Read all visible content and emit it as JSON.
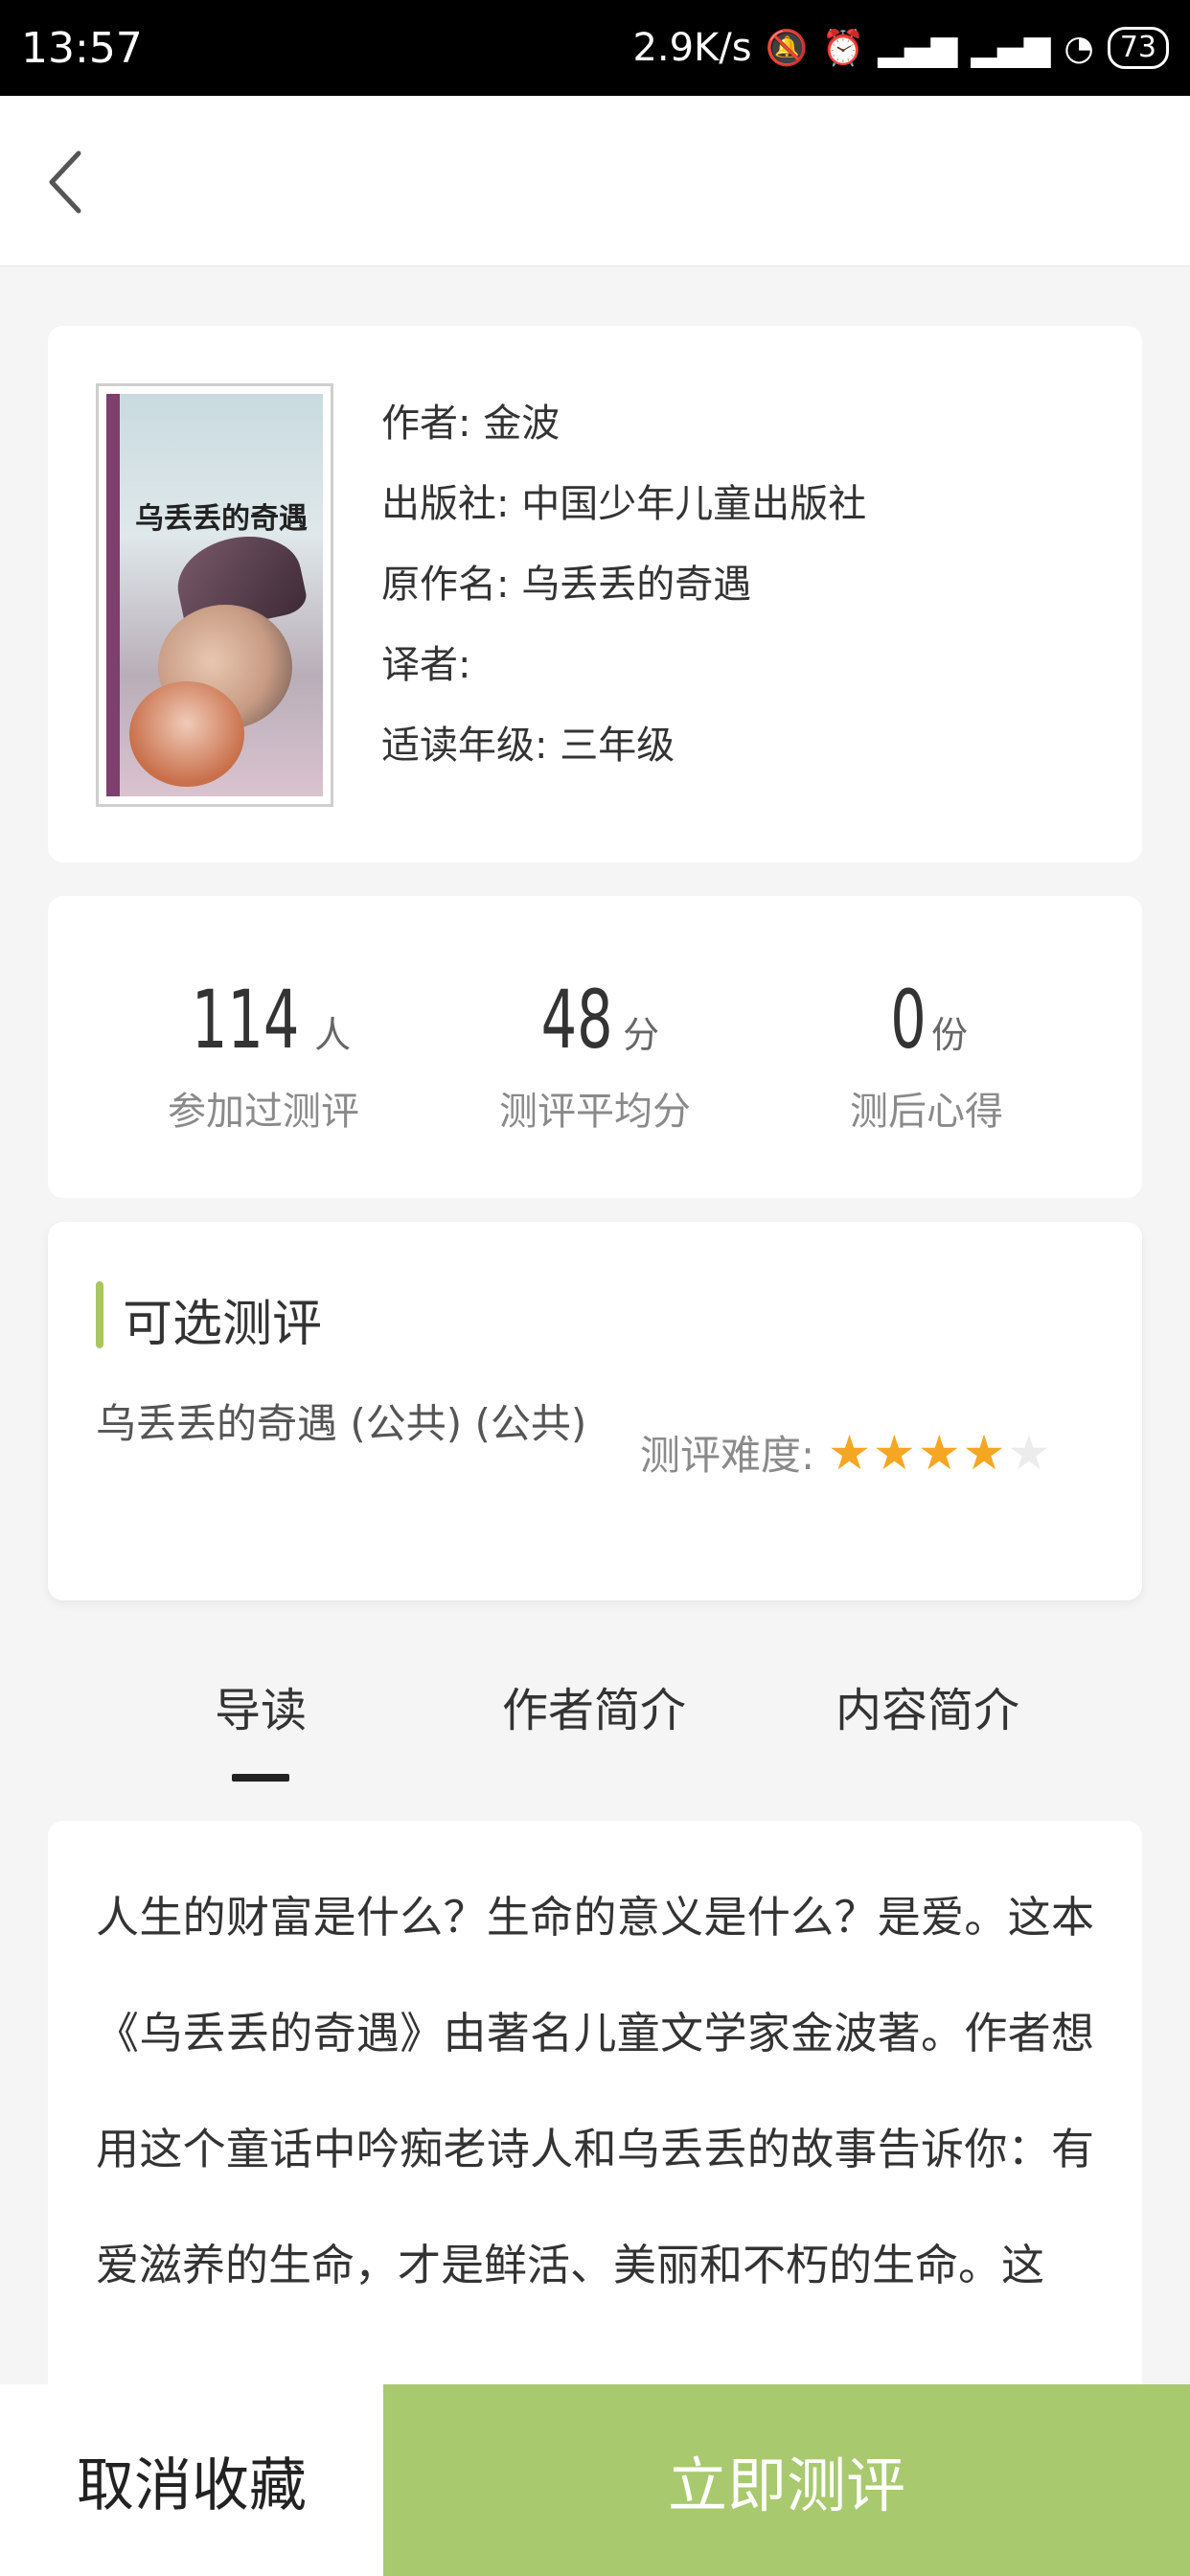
{
  "status_bar": {
    "time": "13:57",
    "network_speed": "2.9K/s",
    "battery": "73",
    "icons": [
      "mute-icon",
      "alarm-icon",
      "signal-icon",
      "signal-icon",
      "wifi-icon",
      "battery-icon"
    ]
  },
  "nav": {
    "back_icon": "chevron-left-icon"
  },
  "book": {
    "cover": {
      "title": "乌丢丢的奇遇"
    },
    "author": "作者: 金波",
    "publisher": "出版社: 中国少年儿童出版社",
    "original_title": "原作名: 乌丢丢的奇遇",
    "translator": "译者:",
    "grade": "适读年级: 三年级"
  },
  "stats": [
    {
      "value": "114",
      "unit": "人",
      "label": "参加过测评"
    },
    {
      "value": "48",
      "unit": "分",
      "label": "测评平均分"
    },
    {
      "value": "0",
      "unit": "份",
      "label": "测后心得"
    }
  ],
  "evaluations": {
    "title": "可选测评",
    "accent_color": "#a8c75e",
    "item_name": "乌丢丢的奇遇 (公共) (公共)",
    "difficulty_label": "测评难度:",
    "difficulty_rating": 4,
    "difficulty_max": 5,
    "star_color": "#f5a623"
  },
  "tabs": [
    {
      "label": "导读",
      "active": true
    },
    {
      "label": "作者简介",
      "active": false
    },
    {
      "label": "内容简介",
      "active": false
    }
  ],
  "intro_text": "人生的财富是什么？生命的意义是什么？是爱。这本《乌丢丢的奇遇》由著名儿童文学家金波著。作者想用这个童话中吟痴老诗人和乌丢丢的故事告诉你：有爱滋养的生命，才是鲜活、美丽和不朽的生命。这",
  "bottom": {
    "cancel_label": "取消收藏",
    "start_label": "立即测评",
    "start_color": "#a8c96e"
  }
}
